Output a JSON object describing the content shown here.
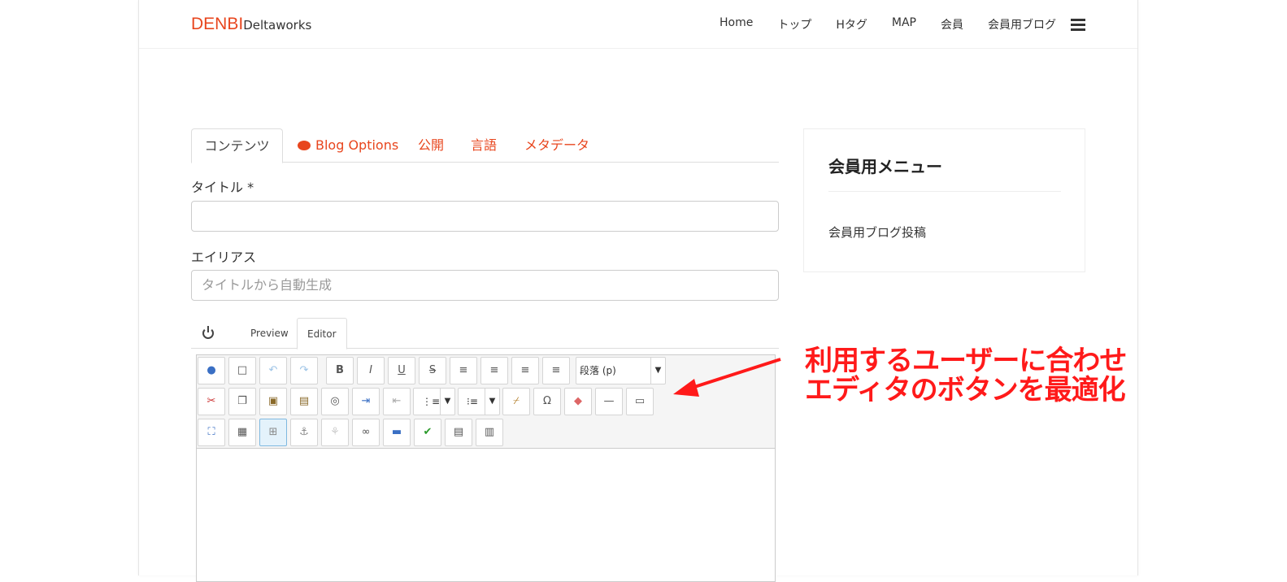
{
  "brand": {
    "main": "DENBI",
    "sub": "Deltaworks"
  },
  "nav": {
    "items": [
      "Home",
      "トップ",
      "Hタグ",
      "MAP",
      "会員",
      "会員用ブログ"
    ]
  },
  "tabs": [
    {
      "label": "コンテンツ"
    },
    {
      "label": "Blog Options"
    },
    {
      "label": "公開"
    },
    {
      "label": "言語"
    },
    {
      "label": "メタデータ"
    }
  ],
  "form": {
    "title_label": "タイトル *",
    "title_value": "",
    "alias_label": "エイリアス",
    "alias_placeholder": "タイトルから自動生成"
  },
  "editor": {
    "tabs": [
      "Preview",
      "Editor"
    ],
    "format_select": "段落 (p)"
  },
  "annotation": {
    "line1": "利用するユーザーに合わせ",
    "line2": "エディタのボタンを最適化",
    "color": "#ff1a1a"
  },
  "sidebar": {
    "title": "会員用メニュー",
    "item": "会員用ブログ投稿"
  },
  "colors": {
    "accent": "#e8461e"
  }
}
